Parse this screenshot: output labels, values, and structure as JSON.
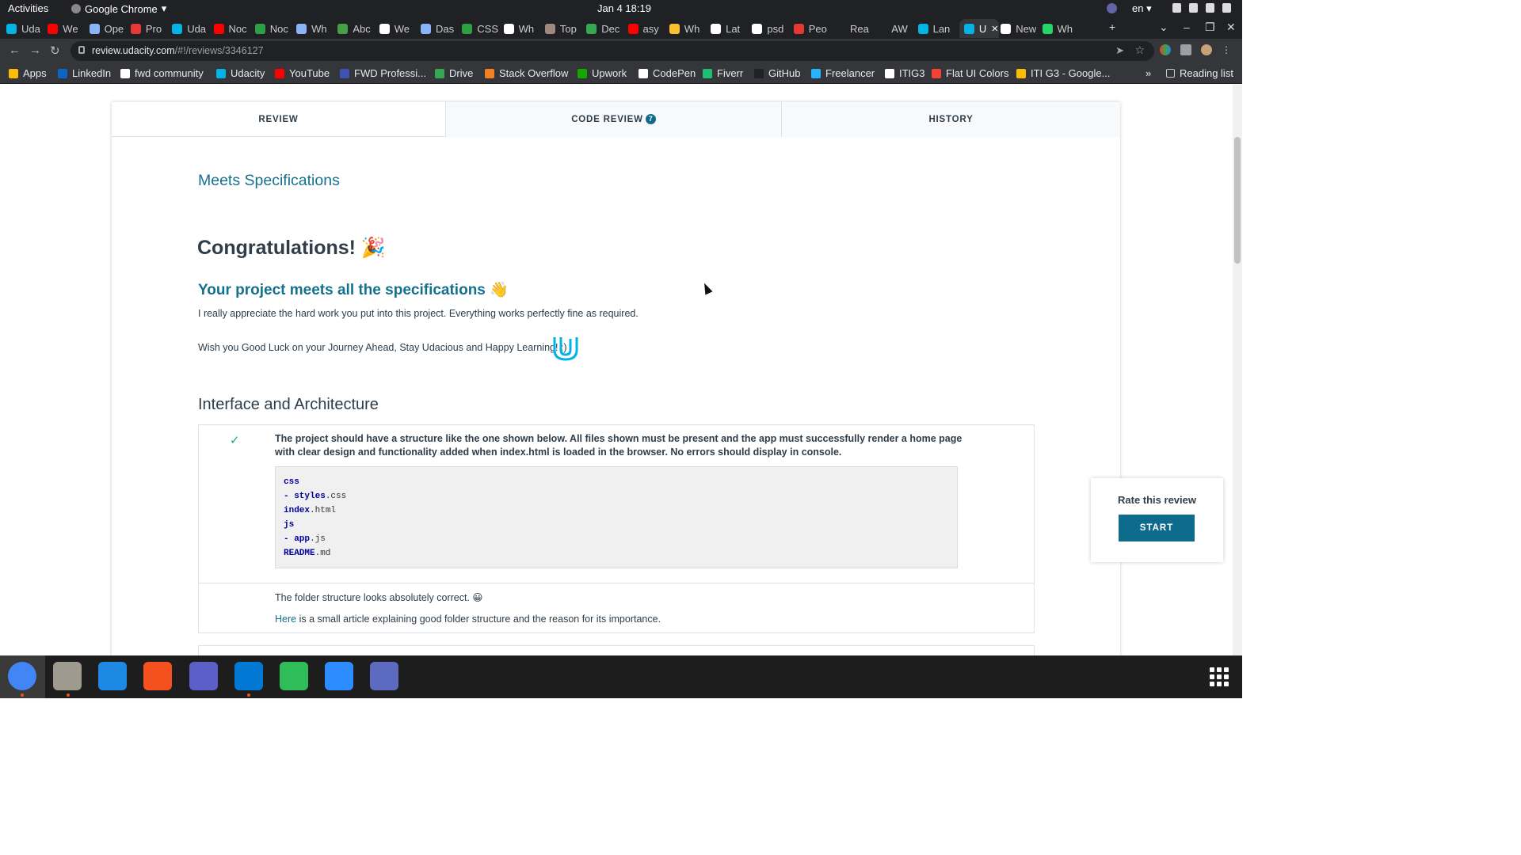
{
  "topbar": {
    "activities": "Activities",
    "app_name": "Google Chrome",
    "clock": "Jan 4  18:19",
    "lang": "en"
  },
  "tabs": [
    {
      "label": "Uda",
      "color": "#02b3e4"
    },
    {
      "label": "We",
      "color": "#ff0000"
    },
    {
      "label": "Ope",
      "color": "#8ab4f8"
    },
    {
      "label": "Pro",
      "color": "#e53935"
    },
    {
      "label": "Uda",
      "color": "#02b3e4"
    },
    {
      "label": "Noc",
      "color": "#ff0000"
    },
    {
      "label": "Noc",
      "color": "#2ea043"
    },
    {
      "label": "Wh",
      "color": "#8ab4f8"
    },
    {
      "label": "Abc",
      "color": "#43a047"
    },
    {
      "label": "We",
      "color": "#ffffff"
    },
    {
      "label": "Das",
      "color": "#8ab4f8"
    },
    {
      "label": "CSS",
      "color": "#2ea043"
    },
    {
      "label": "Wh",
      "color": "#ffffff"
    },
    {
      "label": "Top",
      "color": "#a1887f"
    },
    {
      "label": "Dec",
      "color": "#34a853"
    },
    {
      "label": "asy",
      "color": "#ff0000"
    },
    {
      "label": "Wh",
      "color": "#fbc02d"
    },
    {
      "label": "Lat",
      "color": "#ffffff"
    },
    {
      "label": "psd",
      "color": "#ffffff"
    },
    {
      "label": "Peo",
      "color": "#e53935"
    },
    {
      "label": "Rea",
      "color": "#202124"
    },
    {
      "label": "AW",
      "color": "#202124"
    },
    {
      "label": "Lan",
      "color": "#02b3e4"
    },
    {
      "label": "U",
      "color": "#02b3e4"
    },
    {
      "label": "New",
      "color": "#ffffff"
    },
    {
      "label": "Wh",
      "color": "#25d366"
    }
  ],
  "address": {
    "host": "review.udacity.com",
    "path": "/#!/reviews/3346127"
  },
  "bookmarks": [
    {
      "label": "Apps",
      "color": "#fbbc04"
    },
    {
      "label": "LinkedIn",
      "color": "#0a66c2"
    },
    {
      "label": "fwd community",
      "color": "#ffffff"
    },
    {
      "label": "Udacity",
      "color": "#02b3e4"
    },
    {
      "label": "YouTube",
      "color": "#ff0000"
    },
    {
      "label": "FWD Professi...",
      "color": "#3f51b5"
    },
    {
      "label": "Drive",
      "color": "#34a853"
    },
    {
      "label": "Stack Overflow",
      "color": "#f48024"
    },
    {
      "label": "Upwork",
      "color": "#14a800"
    },
    {
      "label": "CodePen",
      "color": "#ffffff"
    },
    {
      "label": "Fiverr",
      "color": "#1dbf73"
    },
    {
      "label": "GitHub",
      "color": "#202124"
    },
    {
      "label": "Freelancer",
      "color": "#29b2fe"
    },
    {
      "label": "ITIG3",
      "color": "#ffffff"
    },
    {
      "label": "Flat UI Colors",
      "color": "#f44336"
    },
    {
      "label": "ITI G3 - Google...",
      "color": "#fbbc04"
    }
  ],
  "reading_list": "Reading list",
  "page_tabs": {
    "review": "REVIEW",
    "code_review": "CODE REVIEW",
    "code_review_count": "7",
    "history": "HISTORY"
  },
  "review": {
    "status": "Meets Specifications",
    "congrats": "Congratulations! 🎉",
    "specs_heading": "Your project meets all the specifications 👋",
    "para1": "I really appreciate the hard work you put into this project. Everything works perfectly fine as required.",
    "para2": "Wish you Good Luck on your Journey Ahead, Stay Udacious and Happy Learning! :)",
    "section": "Interface and Architecture",
    "criterion": "The project should have a structure like the one shown below. All files shown must be present and the app must successfully render a home page with clear design and functionality added when index.html is loaded in the browser. No errors should display in console.",
    "code_lines": [
      {
        "kw": "css",
        "rest": ""
      },
      {
        "kw": "- styles",
        "rest": ".css"
      },
      {
        "kw": "index",
        "rest": ".html"
      },
      {
        "kw": "js",
        "rest": ""
      },
      {
        "kw": "- app",
        "rest": ".js"
      },
      {
        "kw": "README",
        "rest": ".md"
      }
    ],
    "comment1": "The folder structure looks absolutely correct. 😀",
    "comment2_link": "Here",
    "comment2": " is a small article explaining good folder structure and the reason for its importance."
  },
  "rate": {
    "title": "Rate this review",
    "button": "START"
  },
  "dock_icons": [
    "chrome-icon",
    "files-icon",
    "writer-icon",
    "app-center-icon",
    "teams-icon",
    "vscode-icon",
    "atom-icon",
    "zoom-icon",
    "screenshot-icon"
  ]
}
